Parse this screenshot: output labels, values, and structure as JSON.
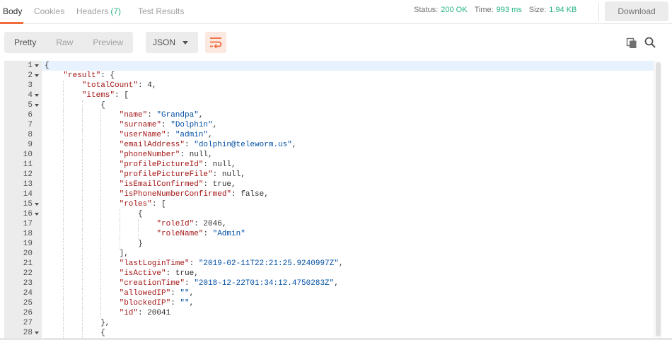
{
  "tabs": [
    {
      "label": "Body"
    },
    {
      "label": "Cookies"
    },
    {
      "label": "Headers",
      "count": "(7)"
    },
    {
      "label": "Test Results"
    }
  ],
  "status": {
    "status_label": "Status:",
    "status_value": "200 OK",
    "time_label": "Time:",
    "time_value": "993 ms",
    "size_label": "Size:",
    "size_value": "1.94 KB"
  },
  "download_label": "Download",
  "view_modes": [
    "Pretty",
    "Raw",
    "Preview"
  ],
  "format_select": {
    "selected": "JSON"
  },
  "icons": {
    "wrap": "wrap-lines-icon",
    "copy": "copy-icon",
    "search": "search-icon"
  },
  "colors": {
    "accent": "#f26b3a",
    "success": "#26b47f",
    "json_key": "#a31515",
    "json_string": "#0451a5"
  },
  "code_lines": [
    {
      "n": "1",
      "fold": true,
      "indent": 0,
      "t": [
        [
          "p",
          "{"
        ]
      ]
    },
    {
      "n": "2",
      "fold": true,
      "indent": 4,
      "t": [
        [
          "k",
          "\"result\""
        ],
        [
          "p",
          ": {"
        ]
      ]
    },
    {
      "n": "3",
      "fold": false,
      "indent": 8,
      "t": [
        [
          "k",
          "\"totalCount\""
        ],
        [
          "p",
          ": "
        ],
        [
          "n",
          "4"
        ],
        [
          "p",
          ","
        ]
      ]
    },
    {
      "n": "4",
      "fold": true,
      "indent": 8,
      "t": [
        [
          "k",
          "\"items\""
        ],
        [
          "p",
          ": ["
        ]
      ]
    },
    {
      "n": "5",
      "fold": true,
      "indent": 12,
      "t": [
        [
          "p",
          "{"
        ]
      ]
    },
    {
      "n": "6",
      "fold": false,
      "indent": 16,
      "t": [
        [
          "k",
          "\"name\""
        ],
        [
          "p",
          ": "
        ],
        [
          "s",
          "\"Grandpa\""
        ],
        [
          "p",
          ","
        ]
      ]
    },
    {
      "n": "7",
      "fold": false,
      "indent": 16,
      "t": [
        [
          "k",
          "\"surname\""
        ],
        [
          "p",
          ": "
        ],
        [
          "s",
          "\"Dolphin\""
        ],
        [
          "p",
          ","
        ]
      ]
    },
    {
      "n": "8",
      "fold": false,
      "indent": 16,
      "t": [
        [
          "k",
          "\"userName\""
        ],
        [
          "p",
          ": "
        ],
        [
          "s",
          "\"admin\""
        ],
        [
          "p",
          ","
        ]
      ]
    },
    {
      "n": "9",
      "fold": false,
      "indent": 16,
      "t": [
        [
          "k",
          "\"emailAddress\""
        ],
        [
          "p",
          ": "
        ],
        [
          "s",
          "\"dolphin@teleworm.us\""
        ],
        [
          "p",
          ","
        ]
      ]
    },
    {
      "n": "10",
      "fold": false,
      "indent": 16,
      "t": [
        [
          "k",
          "\"phoneNumber\""
        ],
        [
          "p",
          ": "
        ],
        [
          "n",
          "null"
        ],
        [
          "p",
          ","
        ]
      ]
    },
    {
      "n": "11",
      "fold": false,
      "indent": 16,
      "t": [
        [
          "k",
          "\"profilePictureId\""
        ],
        [
          "p",
          ": "
        ],
        [
          "n",
          "null"
        ],
        [
          "p",
          ","
        ]
      ]
    },
    {
      "n": "12",
      "fold": false,
      "indent": 16,
      "t": [
        [
          "k",
          "\"profilePictureFile\""
        ],
        [
          "p",
          ": "
        ],
        [
          "n",
          "null"
        ],
        [
          "p",
          ","
        ]
      ]
    },
    {
      "n": "13",
      "fold": false,
      "indent": 16,
      "t": [
        [
          "k",
          "\"isEmailConfirmed\""
        ],
        [
          "p",
          ": "
        ],
        [
          "n",
          "true"
        ],
        [
          "p",
          ","
        ]
      ]
    },
    {
      "n": "14",
      "fold": false,
      "indent": 16,
      "t": [
        [
          "k",
          "\"isPhoneNumberConfirmed\""
        ],
        [
          "p",
          ": "
        ],
        [
          "n",
          "false"
        ],
        [
          "p",
          ","
        ]
      ]
    },
    {
      "n": "15",
      "fold": true,
      "indent": 16,
      "t": [
        [
          "k",
          "\"roles\""
        ],
        [
          "p",
          ": ["
        ]
      ]
    },
    {
      "n": "16",
      "fold": true,
      "indent": 20,
      "t": [
        [
          "p",
          "{"
        ]
      ]
    },
    {
      "n": "17",
      "fold": false,
      "indent": 24,
      "t": [
        [
          "k",
          "\"roleId\""
        ],
        [
          "p",
          ": "
        ],
        [
          "n",
          "2046"
        ],
        [
          "p",
          ","
        ]
      ]
    },
    {
      "n": "18",
      "fold": false,
      "indent": 24,
      "t": [
        [
          "k",
          "\"roleName\""
        ],
        [
          "p",
          ": "
        ],
        [
          "s",
          "\"Admin\""
        ]
      ]
    },
    {
      "n": "19",
      "fold": false,
      "indent": 20,
      "t": [
        [
          "p",
          "}"
        ]
      ]
    },
    {
      "n": "20",
      "fold": false,
      "indent": 16,
      "t": [
        [
          "p",
          "],"
        ]
      ]
    },
    {
      "n": "21",
      "fold": false,
      "indent": 16,
      "t": [
        [
          "k",
          "\"lastLoginTime\""
        ],
        [
          "p",
          ": "
        ],
        [
          "s",
          "\"2019-02-11T22:21:25.9240997Z\""
        ],
        [
          "p",
          ","
        ]
      ]
    },
    {
      "n": "22",
      "fold": false,
      "indent": 16,
      "t": [
        [
          "k",
          "\"isActive\""
        ],
        [
          "p",
          ": "
        ],
        [
          "n",
          "true"
        ],
        [
          "p",
          ","
        ]
      ]
    },
    {
      "n": "23",
      "fold": false,
      "indent": 16,
      "t": [
        [
          "k",
          "\"creationTime\""
        ],
        [
          "p",
          ": "
        ],
        [
          "s",
          "\"2018-12-22T01:34:12.4750283Z\""
        ],
        [
          "p",
          ","
        ]
      ]
    },
    {
      "n": "24",
      "fold": false,
      "indent": 16,
      "t": [
        [
          "k",
          "\"allowedIP\""
        ],
        [
          "p",
          ": "
        ],
        [
          "s",
          "\"\""
        ],
        [
          "p",
          ","
        ]
      ]
    },
    {
      "n": "25",
      "fold": false,
      "indent": 16,
      "t": [
        [
          "k",
          "\"blockedIP\""
        ],
        [
          "p",
          ": "
        ],
        [
          "s",
          "\"\""
        ],
        [
          "p",
          ","
        ]
      ]
    },
    {
      "n": "26",
      "fold": false,
      "indent": 16,
      "t": [
        [
          "k",
          "\"id\""
        ],
        [
          "p",
          ": "
        ],
        [
          "n",
          "20041"
        ]
      ]
    },
    {
      "n": "27",
      "fold": false,
      "indent": 12,
      "t": [
        [
          "p",
          "},"
        ]
      ]
    },
    {
      "n": "28",
      "fold": true,
      "indent": 12,
      "t": [
        [
          "p",
          "{"
        ]
      ]
    }
  ]
}
